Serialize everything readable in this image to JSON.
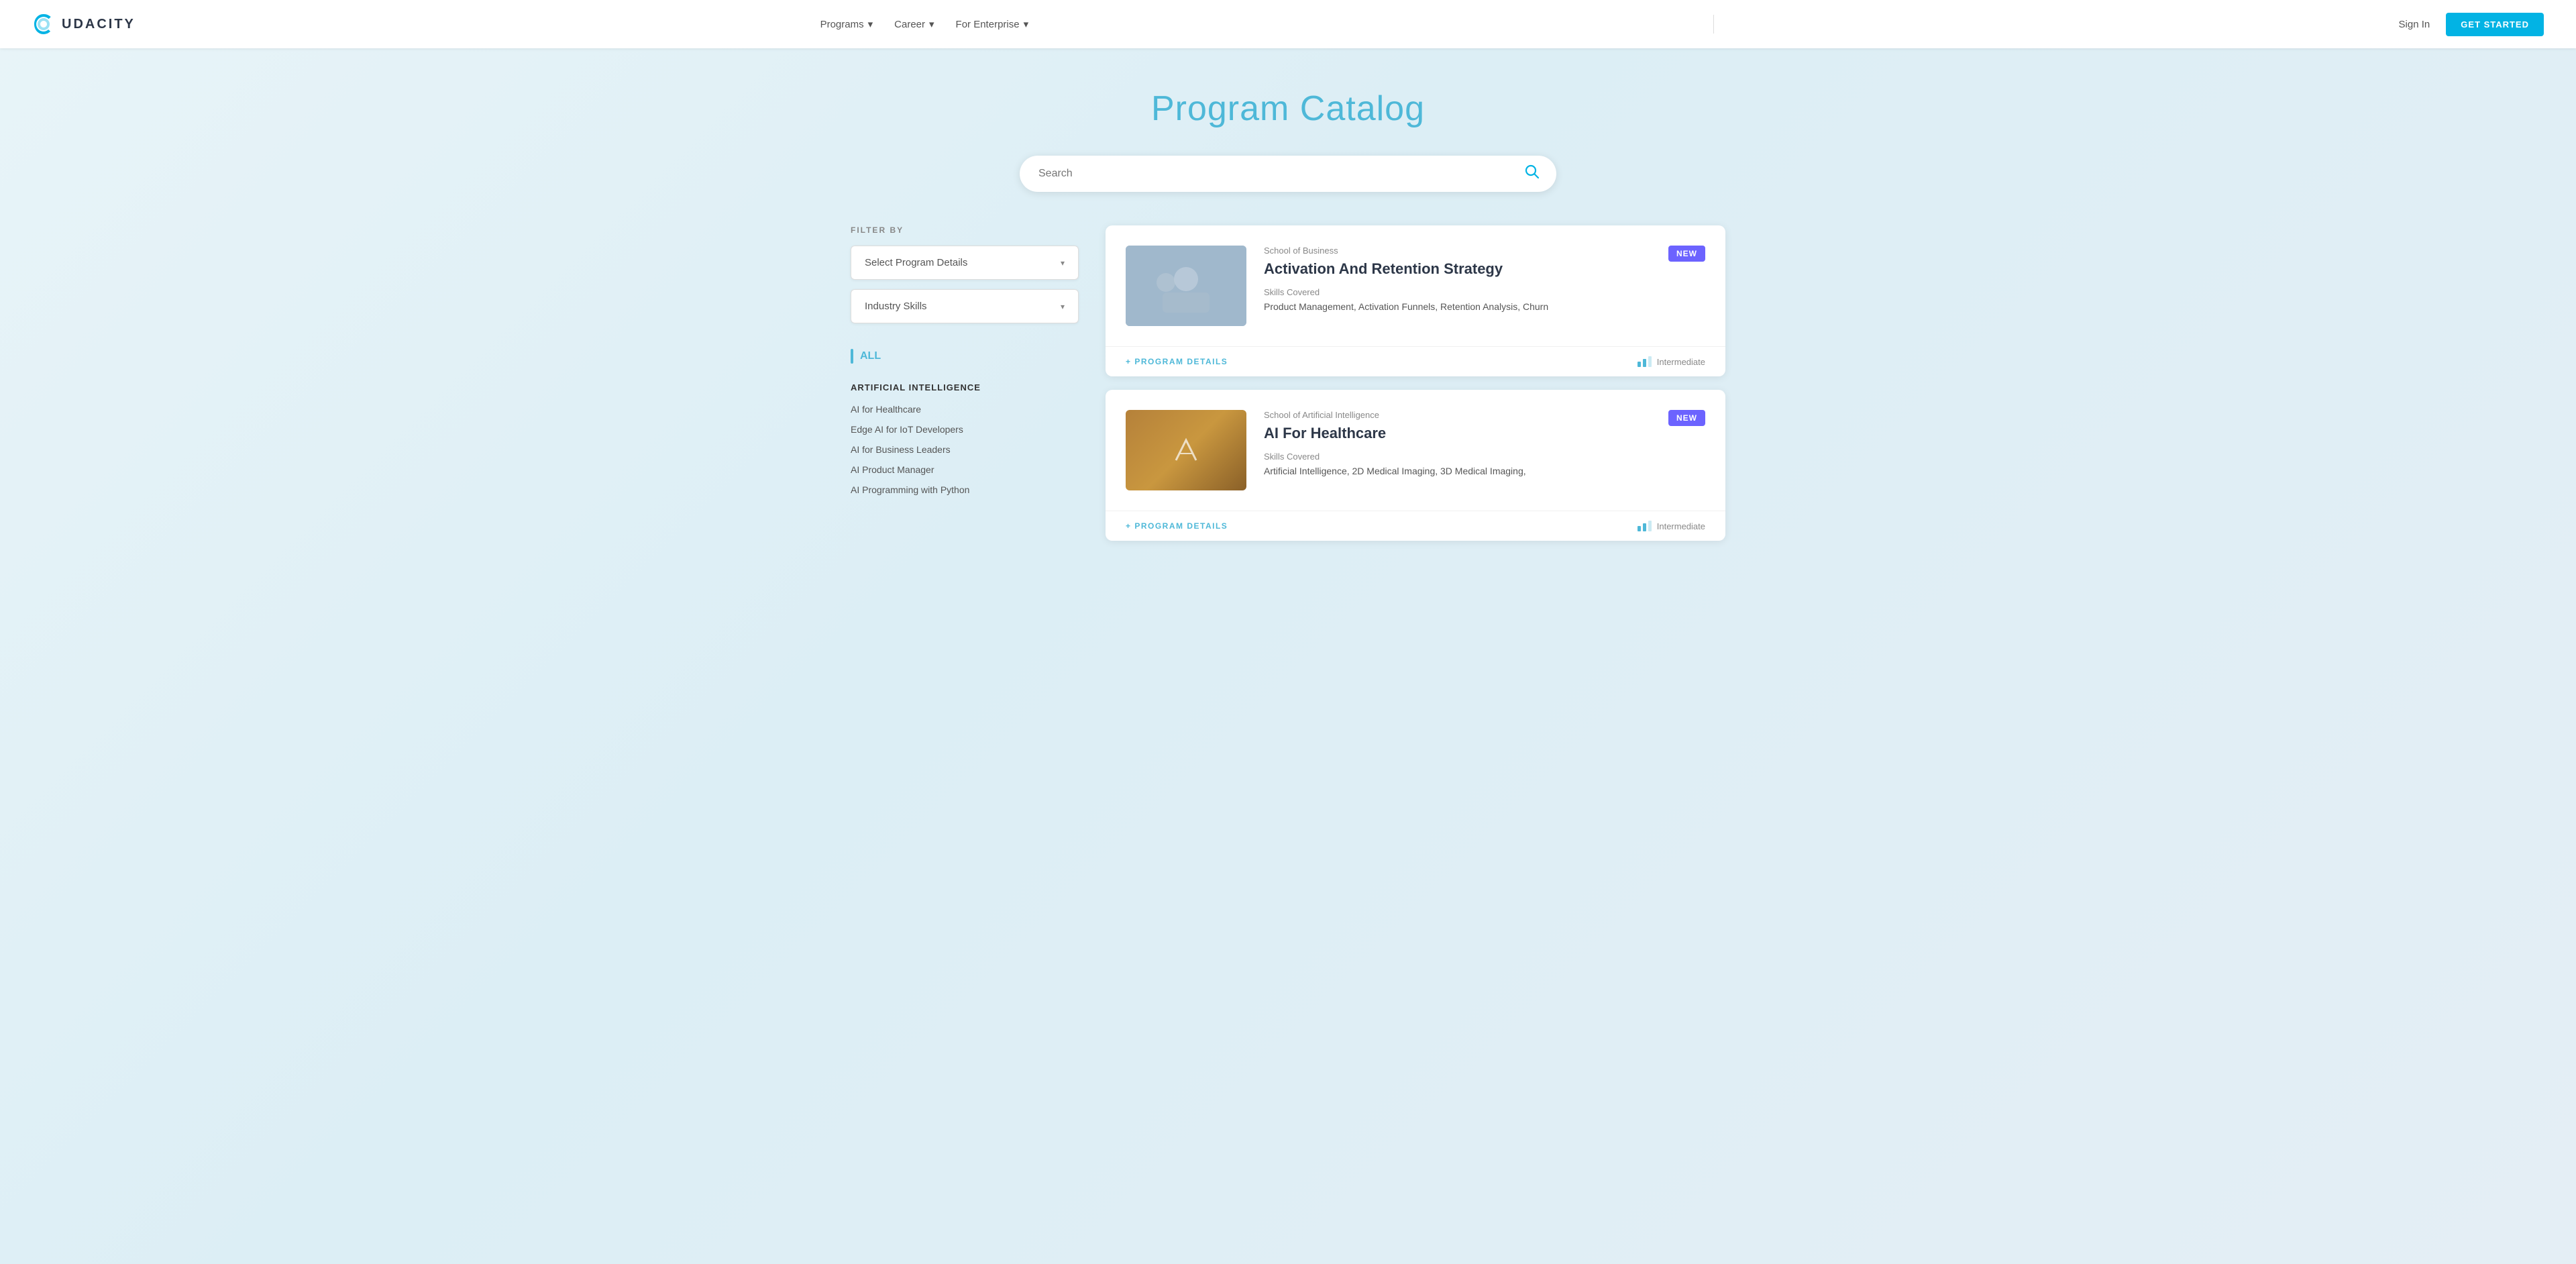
{
  "nav": {
    "logo_text": "UDACITY",
    "items": [
      {
        "label": "Programs",
        "has_dropdown": true
      },
      {
        "label": "Career",
        "has_dropdown": true
      },
      {
        "label": "For Enterprise",
        "has_dropdown": true
      }
    ],
    "sign_in": "Sign In",
    "get_started": "GET STARTED"
  },
  "page": {
    "title": "Program Catalog"
  },
  "search": {
    "placeholder": "Search"
  },
  "filters": {
    "label": "FILTER BY",
    "dropdown1": "Select Program Details",
    "dropdown2": "Industry Skills"
  },
  "sidebar": {
    "all_label": "ALL",
    "category_title": "ARTIFICIAL INTELLIGENCE",
    "items": [
      {
        "label": "AI for Healthcare"
      },
      {
        "label": "Edge AI for IoT Developers"
      },
      {
        "label": "AI for Business Leaders"
      },
      {
        "label": "AI Product Manager"
      },
      {
        "label": "AI Programming with Python"
      }
    ]
  },
  "cards": [
    {
      "school": "School of Business",
      "title": "Activation And Retention Strategy",
      "skills_label": "Skills Covered",
      "skills": "Product Management, Activation Funnels, Retention Analysis, Churn",
      "badge": "NEW",
      "level": "Intermediate",
      "type": "business"
    },
    {
      "school": "School of Artificial Intelligence",
      "title": "AI For Healthcare",
      "skills_label": "Skills Covered",
      "skills": "Artificial Intelligence, 2D Medical Imaging, 3D Medical Imaging,",
      "badge": "NEW",
      "level": "Intermediate",
      "type": "ai"
    }
  ],
  "program_details_link": "+ PROGRAM DETAILS",
  "icons": {
    "chevron_down": "▾",
    "search": "🔍",
    "plus": "+"
  }
}
